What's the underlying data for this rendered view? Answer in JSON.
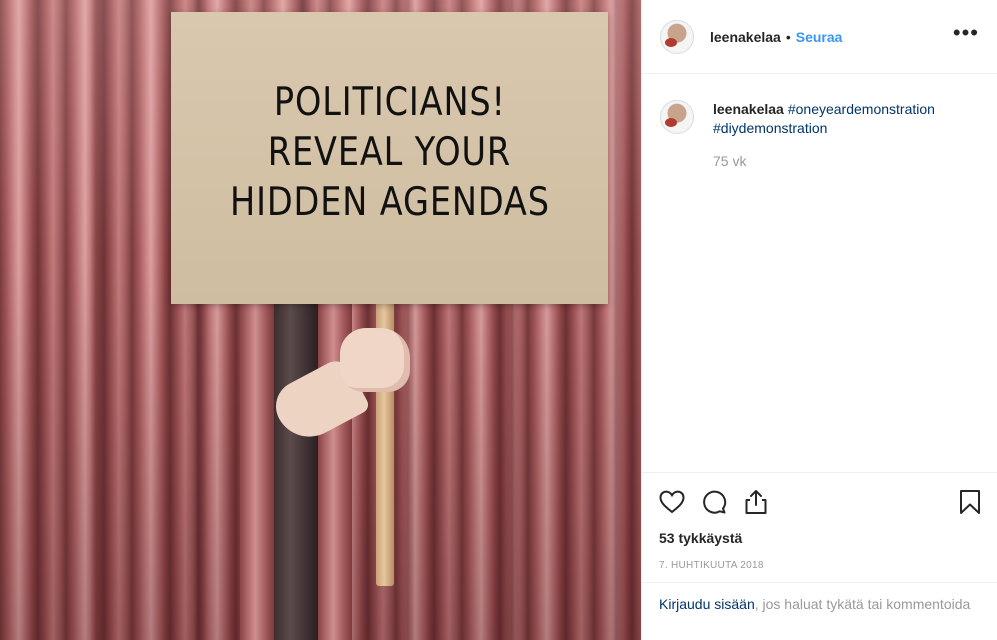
{
  "photo": {
    "sign_lines": [
      "POLITICIANS!",
      "REVEAL YOUR",
      "HIDDEN AGENDAS"
    ]
  },
  "header": {
    "username": "leenakelaa",
    "separator": "•",
    "follow_label": "Seuraa",
    "more_icon": "more-horizontal-icon"
  },
  "caption": {
    "username": "leenakelaa",
    "hashtags": [
      "#oneyeardemonstration",
      "#diydemonstration"
    ],
    "age": "75 vk"
  },
  "actions": {
    "icons": [
      "heart-icon",
      "comment-icon",
      "share-icon",
      "bookmark-icon"
    ],
    "likes": "53 tykkäystä",
    "date": "7. HUHTIKUUTA 2018"
  },
  "login": {
    "link_text": "Kirjaudu sisään",
    "rest_text": ", jos haluat tykätä tai kommentoida"
  },
  "colors": {
    "follow_blue": "#3897f0",
    "link_dark_blue": "#003569",
    "muted_gray": "#999999",
    "border": "#efefef"
  }
}
